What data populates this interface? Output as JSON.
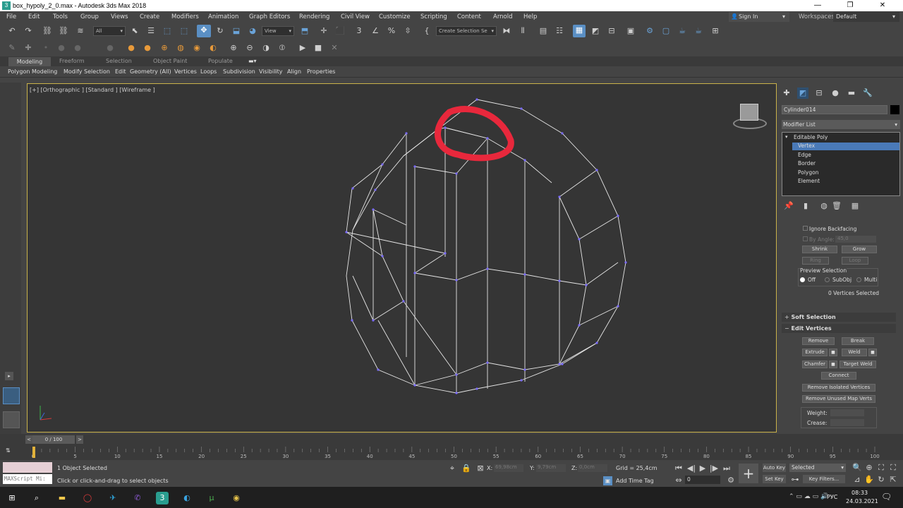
{
  "window": {
    "title": "box_hypoly_2_0.max - Autodesk 3ds Max 2018",
    "min": "—",
    "max": "❐",
    "close": "✕"
  },
  "menu": [
    "File",
    "Edit",
    "Tools",
    "Group",
    "Views",
    "Create",
    "Modifiers",
    "Animation",
    "Graph Editors",
    "Rendering",
    "Civil View",
    "Customize",
    "Scripting",
    "Content",
    "Arnold",
    "Help"
  ],
  "signin": {
    "label": "Sign In",
    "workspaces_label": "Workspaces:",
    "workspace_value": "Default"
  },
  "toolbar": {
    "filter_value": "All",
    "refcoord_value": "View",
    "named_sel_value": "Create Selection Se"
  },
  "ribbon": {
    "tabs": [
      "Modeling",
      "Freeform",
      "Selection",
      "Object Paint",
      "Populate"
    ],
    "row": [
      "Polygon Modeling",
      "Modify Selection",
      "Edit",
      "Geometry (All)",
      "Vertices",
      "Loops",
      "Subdivision",
      "Visibility",
      "Align",
      "Properties"
    ]
  },
  "viewport": {
    "label": "[+] [Orthographic ] [Standard ] [Wireframe ]"
  },
  "command_panel": {
    "object_name": "Cylinder014",
    "modifier_list": "Modifier List",
    "stack": [
      "Editable Poly",
      "Vertex",
      "Edge",
      "Border",
      "Polygon",
      "Element"
    ],
    "selection": {
      "ignore_backfacing": "Ignore Backfacing",
      "by_angle": "By Angle:",
      "angle_value": "45,0",
      "shrink": "Shrink",
      "grow": "Grow",
      "ring": "Ring",
      "loop": "Loop",
      "preview_selection": "Preview Selection",
      "preview_options": [
        "Off",
        "SubObj",
        "Multi"
      ],
      "count": "0 Vertices Selected"
    },
    "soft_selection": "Soft Selection",
    "edit_vertices": {
      "title": "Edit Vertices",
      "remove": "Remove",
      "break": "Break",
      "extrude": "Extrude",
      "weld": "Weld",
      "chamfer": "Chamfer",
      "target_weld": "Target Weld",
      "connect": "Connect",
      "remove_isolated": "Remove Isolated Vertices",
      "remove_unused": "Remove Unused Map Verts",
      "weight": "Weight:",
      "crease": "Crease:"
    }
  },
  "timeline": {
    "frame_label": "0 / 100"
  },
  "trackbar": {
    "ticks": [
      "0",
      "5",
      "10",
      "15",
      "20",
      "25",
      "30",
      "35",
      "40",
      "45",
      "50",
      "55",
      "60",
      "65",
      "70",
      "75",
      "80",
      "85",
      "90",
      "95",
      "100"
    ]
  },
  "status": {
    "maxscript": "MAXScript Mi:",
    "objects_selected": "1 Object Selected",
    "prompt": "Click or click-and-drag to select objects",
    "x_label": "X:",
    "x_value": "69,98cm",
    "y_label": "Y:",
    "y_value": "9,79cm",
    "z_label": "Z:",
    "z_value": "0,0cm",
    "grid": "Grid = 25,4cm",
    "add_time_tag": "Add Time Tag",
    "auto_key": "Auto Key",
    "set_key": "Set Key",
    "selected_value": "Selected",
    "key_filters": "Key Filters...",
    "frame_value": "0"
  },
  "taskbar": {
    "lang": "РУС",
    "time": "08:33",
    "date": "24.03.2021"
  },
  "colors": {
    "viewport_border": "#c9b24a",
    "selected_stack": "#4a7ab8",
    "annotation": "#e8283c"
  }
}
